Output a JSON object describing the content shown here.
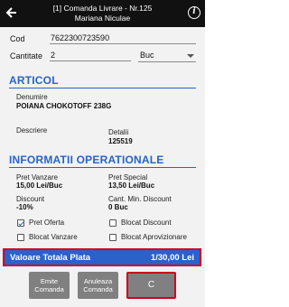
{
  "header": {
    "title_line1": "[1] Comanda Livrare - Nr.125",
    "title_line2": "Mariana Niculae",
    "back_icon": "arrow-left-icon",
    "info_icon": "info-icon",
    "info_glyph": "i"
  },
  "form": {
    "cod_label": "Cod",
    "cod_value": "7622300723590",
    "cantitate_label": "Cantitate",
    "cantitate_value": "2",
    "unit_value": "Buc"
  },
  "articol": {
    "heading": "ARTICOL",
    "denumire_label": "Denumire",
    "denumire_value": "POIANA CHOKOTOFF 238G",
    "descriere_label": "Descriere",
    "detalii_label": "Detalii",
    "detalii_value": "125519"
  },
  "informatii": {
    "heading": "INFORMATII OPERATIONALE",
    "pret_vanzare_label": "Pret Vanzare",
    "pret_vanzare_value": "15,00 Lei/Buc",
    "pret_special_label": "Pret Special",
    "pret_special_value": "13,50 Lei/Buc",
    "discount_label": "Discount",
    "discount_value": "-10%",
    "cant_min_label": "Cant. Min. Discount",
    "cant_min_value": "0 Buc"
  },
  "checkboxes": {
    "pret_oferta": {
      "label": "Pret Oferta",
      "checked": true
    },
    "blocat_discount": {
      "label": "Blocat Discount",
      "checked": false
    },
    "blocat_vanzare": {
      "label": "Blocat Vanzare",
      "checked": false
    },
    "blocat_aprovizionare": {
      "label": "Blocat Aprovizionare",
      "checked": false
    }
  },
  "total": {
    "label": "Valoare Totala Plata",
    "value": "1/30,00 Lei"
  },
  "buttons": {
    "emite_line1": "Emite",
    "emite_line2": "Comanda",
    "anuleaza_line1": "Anuleaza",
    "anuleaza_line2": "Comanda",
    "c_label": "C"
  },
  "colors": {
    "accent": "#2a62c9",
    "highlight": "#d0021b",
    "topbar": "#111111",
    "button": "#808080"
  }
}
